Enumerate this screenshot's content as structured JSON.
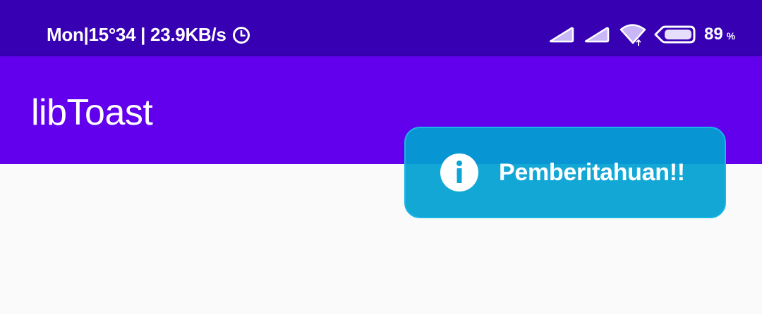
{
  "status_bar": {
    "day_time_speed": "Mon|15°34 | 23.9KB/s",
    "clock_icon": "clock-icon",
    "signal_icons": [
      "cell-signal-icon",
      "cell-signal-icon",
      "wifi-icon",
      "battery-icon"
    ],
    "battery_percent": "89",
    "battery_percent_sign": "%"
  },
  "app_bar": {
    "title": "libToast"
  },
  "toast": {
    "icon": "info-icon",
    "message": "Pemberitahuan!!",
    "color": "#00a0d2"
  },
  "colors": {
    "status_bar": "#3700b3",
    "app_bar": "#6200ee",
    "background": "#fafafa"
  }
}
